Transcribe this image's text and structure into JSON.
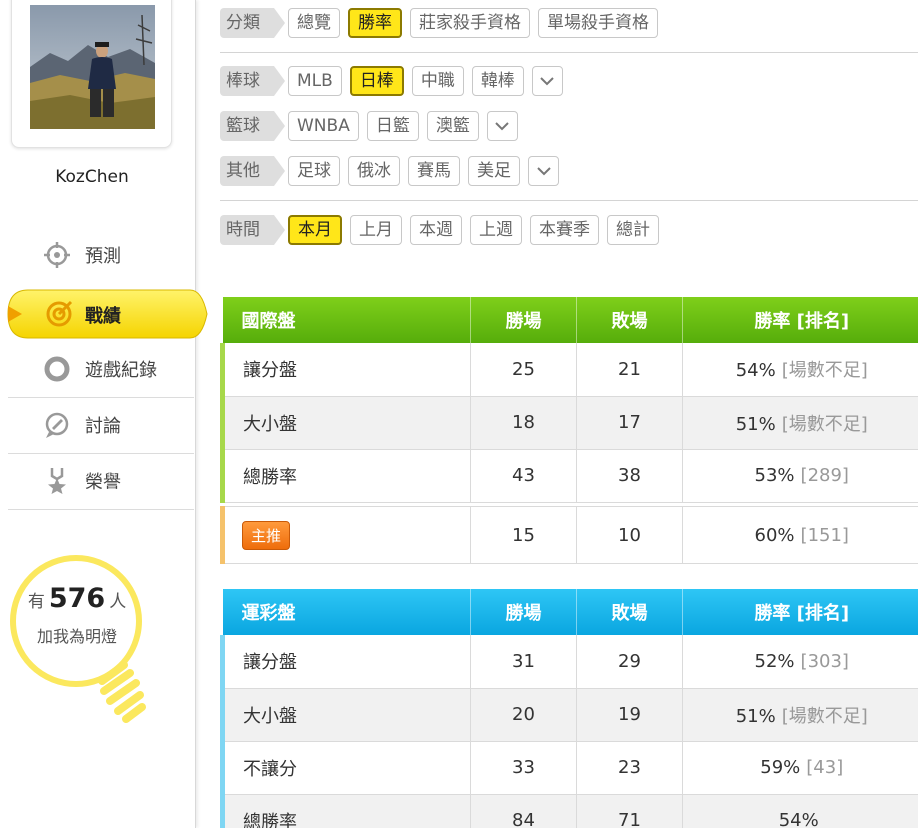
{
  "profile": {
    "username": "KozChen"
  },
  "sidebar": {
    "items": [
      {
        "label": "預測",
        "icon": "crosshair-icon"
      },
      {
        "label": "戰績",
        "icon": "target-icon",
        "active": true
      },
      {
        "label": "遊戲紀錄",
        "icon": "ring-icon"
      },
      {
        "label": "討論",
        "icon": "chat-icon"
      },
      {
        "label": "榮譽",
        "icon": "medal-icon"
      }
    ]
  },
  "fans": {
    "prefix": "有",
    "count": "576",
    "suffix": "人",
    "caption": "加我為明燈"
  },
  "filters": {
    "category": {
      "label": "分類",
      "options": [
        "總覽",
        "勝率",
        "莊家殺手資格",
        "單場殺手資格"
      ],
      "active": "勝率"
    },
    "baseball": {
      "label": "棒球",
      "options": [
        "MLB",
        "日棒",
        "中職",
        "韓棒"
      ],
      "active": "日棒"
    },
    "basketball": {
      "label": "籃球",
      "options": [
        "WNBA",
        "日籃",
        "澳籃"
      ]
    },
    "other": {
      "label": "其他",
      "options": [
        "足球",
        "俄冰",
        "賽馬",
        "美足"
      ]
    },
    "time": {
      "label": "時間",
      "options": [
        "本月",
        "上月",
        "本週",
        "上週",
        "本賽季",
        "總計"
      ],
      "active": "本月"
    }
  },
  "intl_table": {
    "headers": [
      "國際盤",
      "勝場",
      "敗場",
      "勝率 [排名]"
    ],
    "rows": [
      {
        "name": "讓分盤",
        "win": "25",
        "loss": "21",
        "rate": "54%",
        "rank": "[場數不足]"
      },
      {
        "name": "大小盤",
        "win": "18",
        "loss": "17",
        "rate": "51%",
        "rank": "[場數不足]"
      },
      {
        "name": "總勝率",
        "win": "43",
        "loss": "38",
        "rate": "53%",
        "rank": "[289]"
      }
    ],
    "main": {
      "badge": "主推",
      "win": "15",
      "loss": "10",
      "rate": "60%",
      "rank": "[151]"
    }
  },
  "lottery_table": {
    "headers": [
      "運彩盤",
      "勝場",
      "敗場",
      "勝率 [排名]"
    ],
    "rows": [
      {
        "name": "讓分盤",
        "win": "31",
        "loss": "29",
        "rate": "52%",
        "rank": "[303]"
      },
      {
        "name": "大小盤",
        "win": "20",
        "loss": "19",
        "rate": "51%",
        "rank": "[場數不足]"
      },
      {
        "name": "不讓分",
        "win": "33",
        "loss": "23",
        "rate": "59%",
        "rank": "[43]"
      },
      {
        "name": "總勝率",
        "win": "84",
        "loss": "71",
        "rate": "54%",
        "rank": ""
      }
    ]
  },
  "colors": {
    "active_chip": "#ffe619",
    "intl_header": "#62b80f",
    "lottery_header": "#17b2e8",
    "main_badge": "#f07a18"
  }
}
